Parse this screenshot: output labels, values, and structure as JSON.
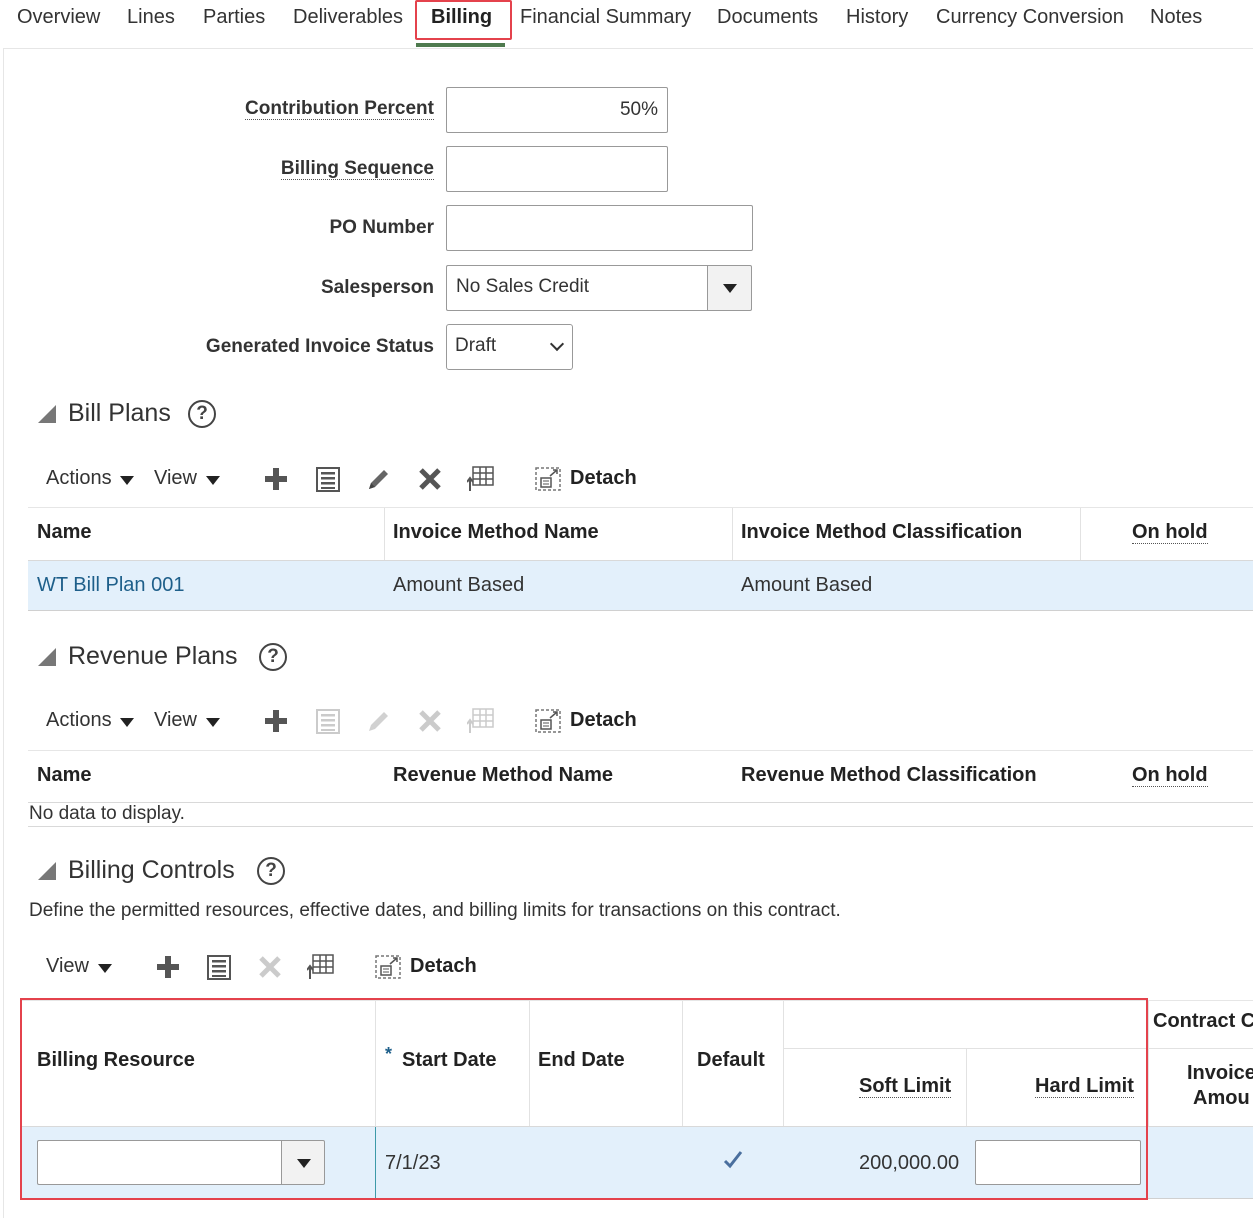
{
  "tabs": [
    {
      "label": "Overview"
    },
    {
      "label": "Lines"
    },
    {
      "label": "Parties"
    },
    {
      "label": "Deliverables"
    },
    {
      "label": "Billing"
    },
    {
      "label": "Financial Summary"
    },
    {
      "label": "Documents"
    },
    {
      "label": "History"
    },
    {
      "label": "Currency Conversion"
    },
    {
      "label": "Notes"
    }
  ],
  "active_tab": "Billing",
  "form": {
    "contribution_percent": {
      "label": "Contribution Percent",
      "value": "50%"
    },
    "billing_sequence": {
      "label": "Billing Sequence",
      "value": ""
    },
    "po_number": {
      "label": "PO Number",
      "value": ""
    },
    "salesperson": {
      "label": "Salesperson",
      "value": "No Sales Credit"
    },
    "generated_invoice_status": {
      "label": "Generated Invoice Status",
      "value": "Draft"
    }
  },
  "bill_plans": {
    "title": "Bill Plans",
    "help": "?",
    "toolbar": {
      "actions": "Actions",
      "view": "View",
      "detach": "Detach"
    },
    "columns": [
      "Name",
      "Invoice Method Name",
      "Invoice Method Classification",
      "On hold"
    ],
    "rows": [
      {
        "name": "WT Bill Plan 001",
        "invoice_method_name": "Amount Based",
        "invoice_method_classification": "Amount Based",
        "on_hold": ""
      }
    ]
  },
  "revenue_plans": {
    "title": "Revenue Plans",
    "help": "?",
    "toolbar": {
      "actions": "Actions",
      "view": "View",
      "detach": "Detach"
    },
    "columns": [
      "Name",
      "Revenue Method Name",
      "Revenue Method Classification",
      "On hold"
    ],
    "empty_text": "No data to display."
  },
  "billing_controls": {
    "title": "Billing Controls",
    "help": "?",
    "description": "Define the permitted resources, effective dates, and billing limits for transactions on this contract.",
    "toolbar": {
      "view": "View",
      "detach": "Detach"
    },
    "columns": {
      "billing_resource": "Billing Resource",
      "required_marker": "*",
      "start_date": "Start Date",
      "end_date": "End Date",
      "default": "Default",
      "soft_limit": "Soft Limit",
      "hard_limit": "Hard Limit",
      "contract_group": "Contract C",
      "invoice_amount_line1": "Invoice",
      "invoice_amount_line2": "Amou"
    },
    "row": {
      "billing_resource": "",
      "start_date": "7/1/23",
      "end_date": "",
      "default_checked": true,
      "soft_limit": "200,000.00",
      "hard_limit": ""
    }
  },
  "colors": {
    "accent_underline": "#4e7a4e",
    "highlight_red": "#e4424c",
    "selected_row": "#e3f0fb",
    "link": "#1e5f8a"
  }
}
